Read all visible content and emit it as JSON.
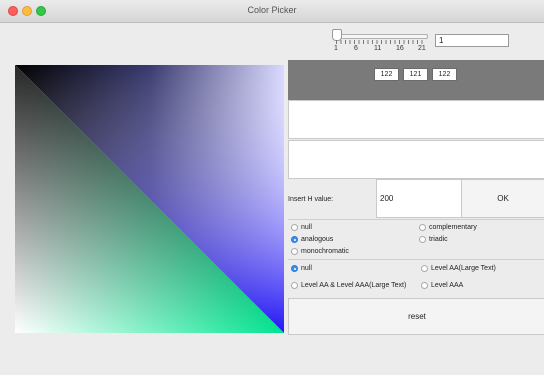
{
  "window": {
    "title": "Color Picker"
  },
  "slider": {
    "ticks": [
      "1",
      "6",
      "11",
      "16",
      "21"
    ],
    "value": "1"
  },
  "rgb": {
    "r": "122",
    "g": "121",
    "b": "122"
  },
  "hue_input": {
    "label": "Insert H value:",
    "value": "200",
    "ok_label": "OK"
  },
  "harmony_options": [
    {
      "label": "null",
      "selected": false
    },
    {
      "label": "complementary",
      "selected": false
    },
    {
      "label": "analogous",
      "selected": true
    },
    {
      "label": "triadic",
      "selected": false
    },
    {
      "label": "monochromatic",
      "selected": false
    }
  ],
  "contrast_options": [
    {
      "label": "null",
      "selected": true
    },
    {
      "label": "Level AA(Large Text)",
      "selected": false
    },
    {
      "label": "Level AA & Level AAA(Large Text)",
      "selected": false
    },
    {
      "label": "Level AAA",
      "selected": false
    }
  ],
  "reset_label": "reset",
  "colors": {
    "gradient_top_right": "#d9d8ff",
    "gradient_bottom_right": "#0f00f5",
    "gradient_mid": "#3a3a70",
    "gradient_green": "#00e58f",
    "rgb_bar": "#797a79"
  },
  "icons": [
    "close-dot",
    "minimize-dot",
    "zoom-dot",
    "radio-selected",
    "radio-unselected"
  ]
}
